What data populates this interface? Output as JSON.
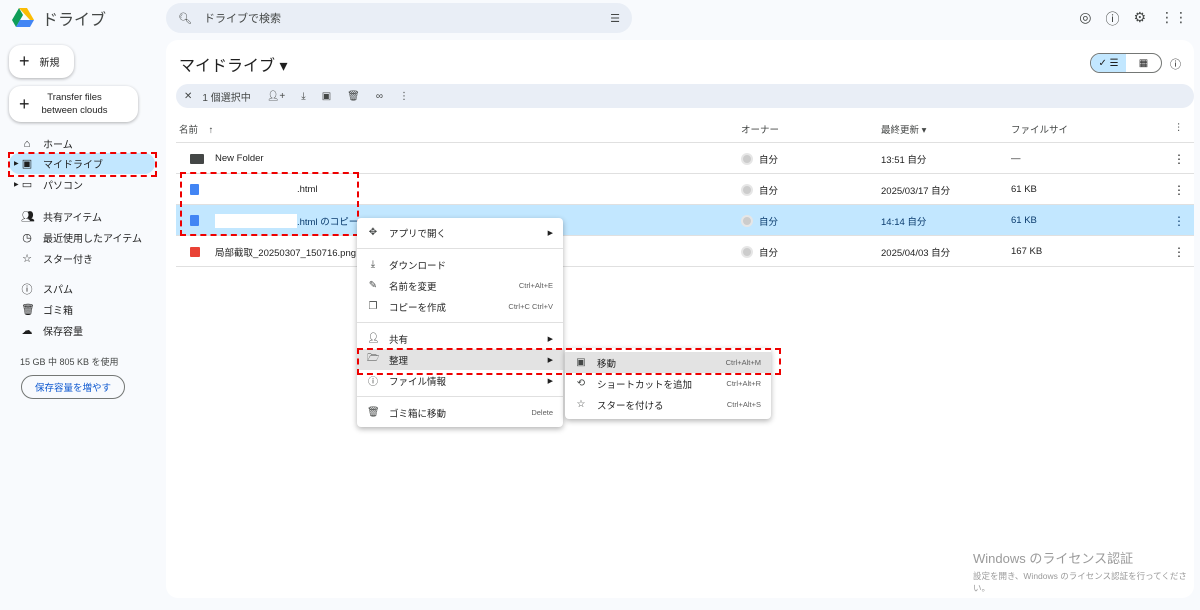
{
  "app": {
    "title": "ドライブ"
  },
  "search": {
    "placeholder": "ドライブで検索"
  },
  "sidebar": {
    "new_label": "新規",
    "transfer_label_1": "Transfer files",
    "transfer_label_2": "between clouds",
    "items": [
      {
        "label": "ホーム"
      },
      {
        "label": "マイドライブ"
      },
      {
        "label": "パソコン"
      },
      {
        "label": "共有アイテム"
      },
      {
        "label": "最近使用したアイテム"
      },
      {
        "label": "スター付き"
      },
      {
        "label": "スパム"
      },
      {
        "label": "ゴミ箱"
      },
      {
        "label": "保存容量"
      }
    ],
    "storage_text": "15 GB 中 805 KB を使用",
    "storage_button": "保存容量を増やす"
  },
  "main": {
    "title": "マイドライブ ▾",
    "selection": "1 個選択中",
    "columns": {
      "name": "名前",
      "owner": "オーナー",
      "modified": "最終更新 ▾",
      "size": "ファイルサイ"
    },
    "rows": [
      {
        "name": "New Folder",
        "owner": "自分",
        "modified": "13:51 自分",
        "size": "—"
      },
      {
        "name": ".html",
        "owner": "自分",
        "modified": "2025/03/17 自分",
        "size": "61 KB"
      },
      {
        "name": ".html のコピー",
        "owner": "自分",
        "modified": "14:14 自分",
        "size": "61 KB"
      },
      {
        "name": "局部截取_20250307_150716.png",
        "owner": "自分",
        "modified": "2025/04/03 自分",
        "size": "167 KB"
      }
    ]
  },
  "context_menu": {
    "items": [
      {
        "label": "アプリで開く"
      },
      {
        "label": "ダウンロード"
      },
      {
        "label": "名前を変更",
        "shortcut": "Ctrl+Alt+E"
      },
      {
        "label": "コピーを作成",
        "shortcut": "Ctrl+C Ctrl+V"
      },
      {
        "label": "共有"
      },
      {
        "label": "整理"
      },
      {
        "label": "ファイル情報"
      },
      {
        "label": "ゴミ箱に移動",
        "shortcut": "Delete"
      }
    ]
  },
  "submenu": {
    "items": [
      {
        "label": "移動",
        "shortcut": "Ctrl+Alt+M"
      },
      {
        "label": "ショートカットを追加",
        "shortcut": "Ctrl+Alt+R"
      },
      {
        "label": "スターを付ける",
        "shortcut": "Ctrl+Alt+S"
      }
    ]
  },
  "watermark": {
    "line1": "Windows のライセンス認証",
    "line2": "設定を開き、Windows のライセンス認証を行ってください。"
  }
}
